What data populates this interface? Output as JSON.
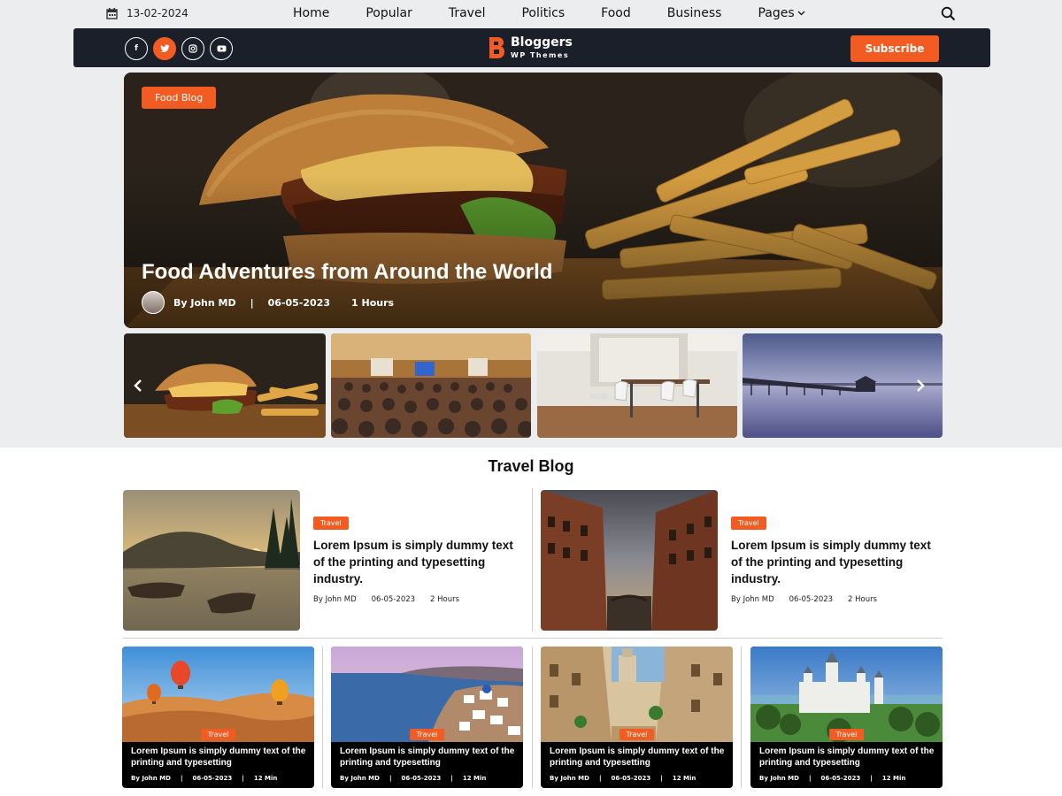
{
  "topbar": {
    "date": "13-02-2024",
    "menu": [
      "Home",
      "Popular",
      "Travel",
      "Politics",
      "Food",
      "Business"
    ],
    "pages_label": "Pages"
  },
  "brand": {
    "name": "Bloggers",
    "tagline": "WP Themes",
    "subscribe_label": "Subscribe",
    "socials": [
      "facebook-icon",
      "twitter-icon",
      "instagram-icon",
      "youtube-icon"
    ],
    "accent": "#f25c22",
    "bar_color": "#1b1f2a"
  },
  "hero": {
    "tag": "Food Blog",
    "title": "Food Adventures from Around the World",
    "author": "By John MD",
    "separator": "|",
    "date": "06-05-2023",
    "read_time": "1 Hours"
  },
  "travel": {
    "section_title": "Travel Blog",
    "featured": [
      {
        "tag": "Travel",
        "title": "Lorem Ipsum is simply dummy text of the printing and typesetting industry.",
        "author": "By John MD",
        "date": "06-05-2023",
        "read_time": "2 Hours"
      },
      {
        "tag": "Travel",
        "title": "Lorem Ipsum is simply dummy text of the printing and typesetting industry.",
        "author": "By John MD",
        "date": "06-05-2023",
        "read_time": "2 Hours"
      }
    ],
    "grid": [
      {
        "tag": "Travel",
        "title": "Lorem Ipsum is simply dummy text of the printing and typesetting",
        "author": "By John MD",
        "sep": "|",
        "date": "06-05-2023",
        "read_time": "12 Min"
      },
      {
        "tag": "Travel",
        "title": "Lorem Ipsum is simply dummy text of the printing and typesetting",
        "author": "By John MD",
        "sep": "|",
        "date": "06-05-2023",
        "read_time": "12 Min"
      },
      {
        "tag": "Travel",
        "title": "Lorem Ipsum is simply dummy text of the printing and typesetting",
        "author": "By John MD",
        "sep": "|",
        "date": "06-05-2023",
        "read_time": "12 Min"
      },
      {
        "tag": "Travel",
        "title": "Lorem Ipsum is simply dummy text of the printing and typesetting",
        "author": "By John MD",
        "sep": "|",
        "date": "06-05-2023",
        "read_time": "12 Min"
      }
    ]
  }
}
